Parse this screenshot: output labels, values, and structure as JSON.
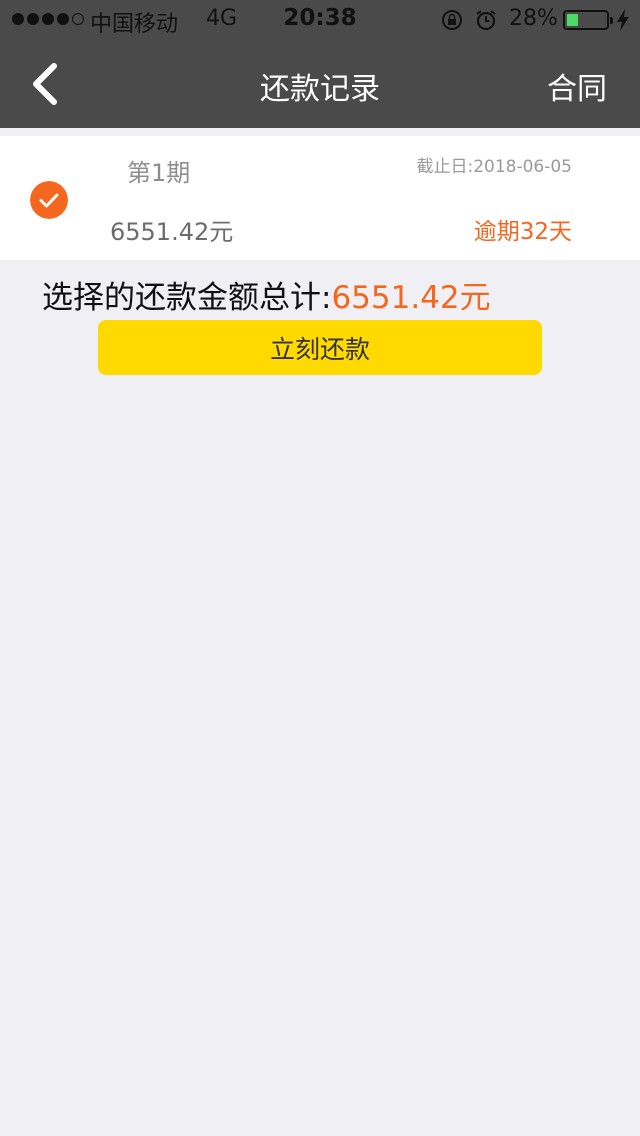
{
  "status_bar": {
    "carrier": "中国移动",
    "network": "4G",
    "time": "20:38",
    "battery_percent_label": "28%",
    "battery_level": 0.28,
    "signal_bars_filled": 4,
    "signal_bars_total": 5
  },
  "nav": {
    "title": "还款记录",
    "right_action": "合同"
  },
  "record": {
    "period": "第1期",
    "due_date": "截止日:2018-06-05",
    "amount": "6551.42元",
    "overdue": "逾期32天",
    "selected": true
  },
  "summary": {
    "label": "选择的还款金额总计:",
    "value": "6551.42元"
  },
  "pay_button": {
    "label": "立刻还款"
  },
  "colors": {
    "nav_bg": "#4a4a4a",
    "accent_orange": "#f5661f",
    "button_yellow": "#ffd900",
    "page_bg": "#efeff4"
  },
  "icons": {
    "back": "chevron-left-icon",
    "check": "check-circle-icon",
    "rotation_lock": "rotation-lock-icon",
    "alarm": "alarm-icon",
    "battery": "battery-icon",
    "charging": "charging-icon"
  }
}
